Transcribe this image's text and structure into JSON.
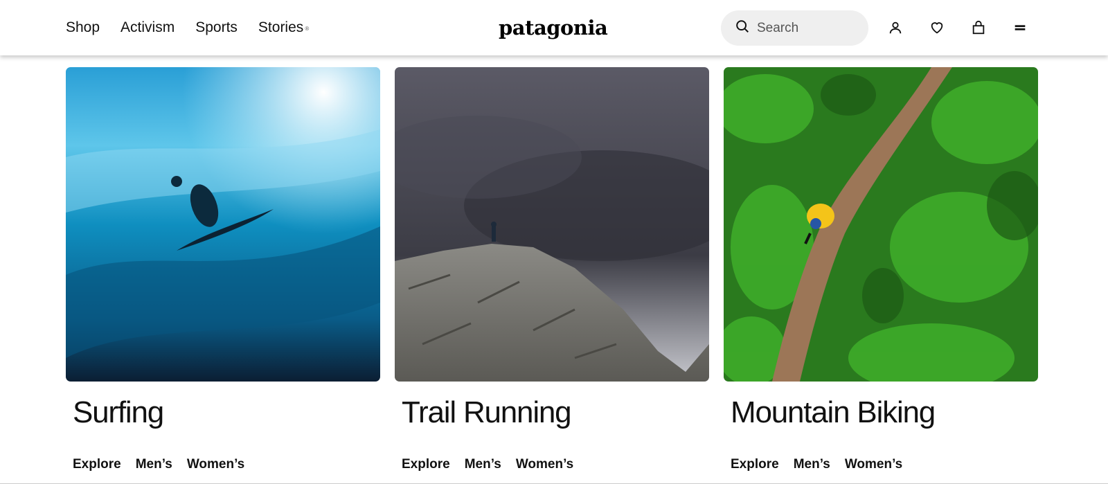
{
  "header": {
    "nav": [
      {
        "label": "Shop"
      },
      {
        "label": "Activism"
      },
      {
        "label": "Sports"
      },
      {
        "label": "Stories",
        "mark": "®"
      }
    ],
    "logo": "patagonia",
    "search": {
      "placeholder": "Search",
      "icon": "search-icon"
    },
    "icons": [
      "account-icon",
      "heart-icon",
      "bag-icon",
      "menu-icon"
    ]
  },
  "cards": [
    {
      "title": "Surfing",
      "links": [
        "Explore",
        "Men’s",
        "Women’s"
      ],
      "image": "surfer-in-wave"
    },
    {
      "title": "Trail Running",
      "links": [
        "Explore",
        "Men’s",
        "Women’s"
      ],
      "image": "runner-on-mountain-ridge"
    },
    {
      "title": "Mountain Biking",
      "links": [
        "Explore",
        "Men’s",
        "Women’s"
      ],
      "image": "biker-on-forest-trail"
    }
  ],
  "colors": {
    "header_bg": "#ffffff",
    "search_bg": "#efefef",
    "text": "#111111"
  }
}
